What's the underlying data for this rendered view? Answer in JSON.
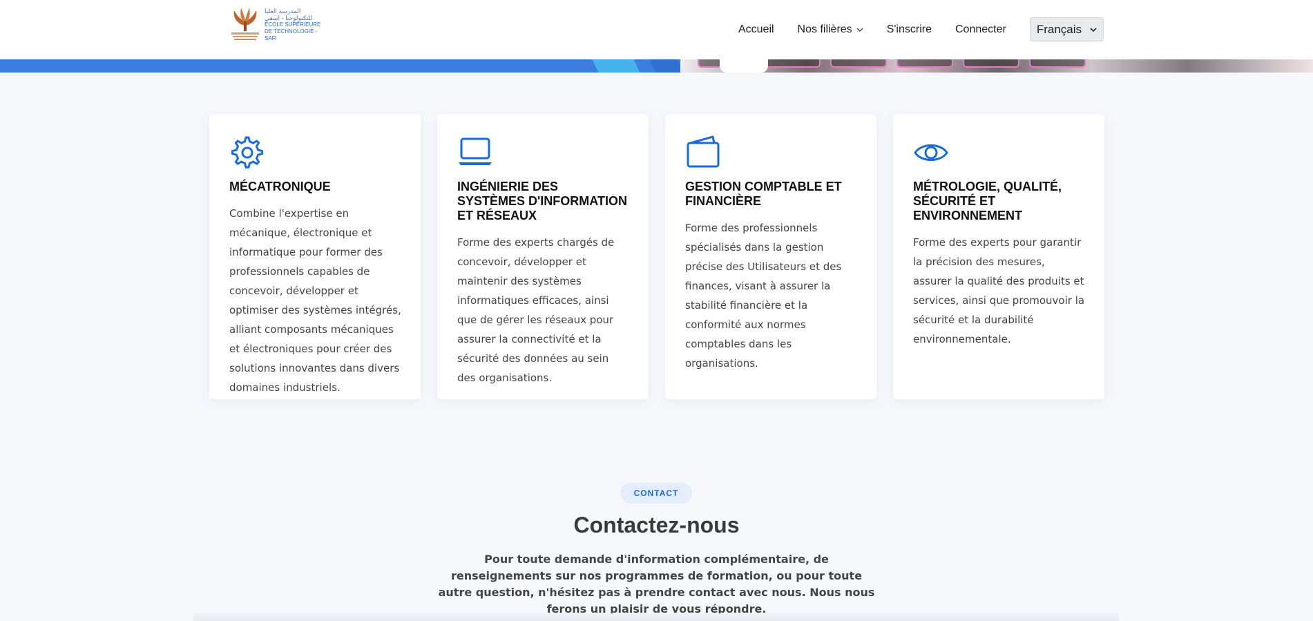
{
  "header": {
    "logo": {
      "arabic_line1": "المدرسة العليا",
      "arabic_line2": "للتكنولوجيا - اسفي",
      "fr_line1": "ÉCOLE  SUPÉRIEURE",
      "fr_line2": "DE TECHNOLOGIE - SAFI",
      "icon": "school-logo"
    },
    "nav": [
      {
        "label": "Accueil"
      },
      {
        "label": "Nos filières",
        "icon": "chevron-down-icon"
      },
      {
        "label": "S'inscrire"
      },
      {
        "label": "Connecter"
      }
    ],
    "language": {
      "selected": "Français",
      "icon": "chevron-down-icon"
    }
  },
  "cards": [
    {
      "icon": "gear-icon",
      "title": "MÉCATRONIQUE",
      "text": "Combine l'expertise en mécanique, électronique et informatique pour former des professionnels capables de concevoir, développer et optimiser des systèmes intégrés, alliant composants mécaniques et électroniques pour créer des solutions innovantes dans divers domaines industriels."
    },
    {
      "icon": "laptop-icon",
      "title": "INGÉNIERIE DES SYSTÈMES D'INFORMATION ET RÉSEAUX",
      "text": "Forme des experts chargés de concevoir, développer et maintenir des systèmes informatiques efficaces, ainsi que de gérer les réseaux pour assurer la connectivité et la sécurité des données au sein des organisations."
    },
    {
      "icon": "wallet-icon",
      "title": "GESTION COMPTABLE ET FINANCIÈRE",
      "text": "Forme des professionnels spécialisés dans la gestion précise des Utilisateurs et des finances, visant à assurer la stabilité financière et la conformité aux normes comptables dans les organisations."
    },
    {
      "icon": "eye-icon",
      "title": "MÉTROLOGIE, QUALITÉ, SÉCURITÉ ET ENVIRONNEMENT",
      "text": "Forme des experts pour garantir la précision des mesures, assurer la qualité des produits et services, ainsi que promouvoir la sécurité et la durabilité environnementale."
    }
  ],
  "contact": {
    "badge": "CONTACT",
    "title": "Contactez-nous",
    "text": "Pour toute demande d'information complémentaire, de renseignements sur nos programmes de formation, ou pour toute autre question, n'hésitez pas à prendre contact avec nous. Nous nous ferons un plaisir de vous répondre."
  },
  "colors": {
    "accent": "#1a6ad8",
    "banner_blue": "#3b7de0",
    "banner_cyan": "#45b4ee"
  }
}
